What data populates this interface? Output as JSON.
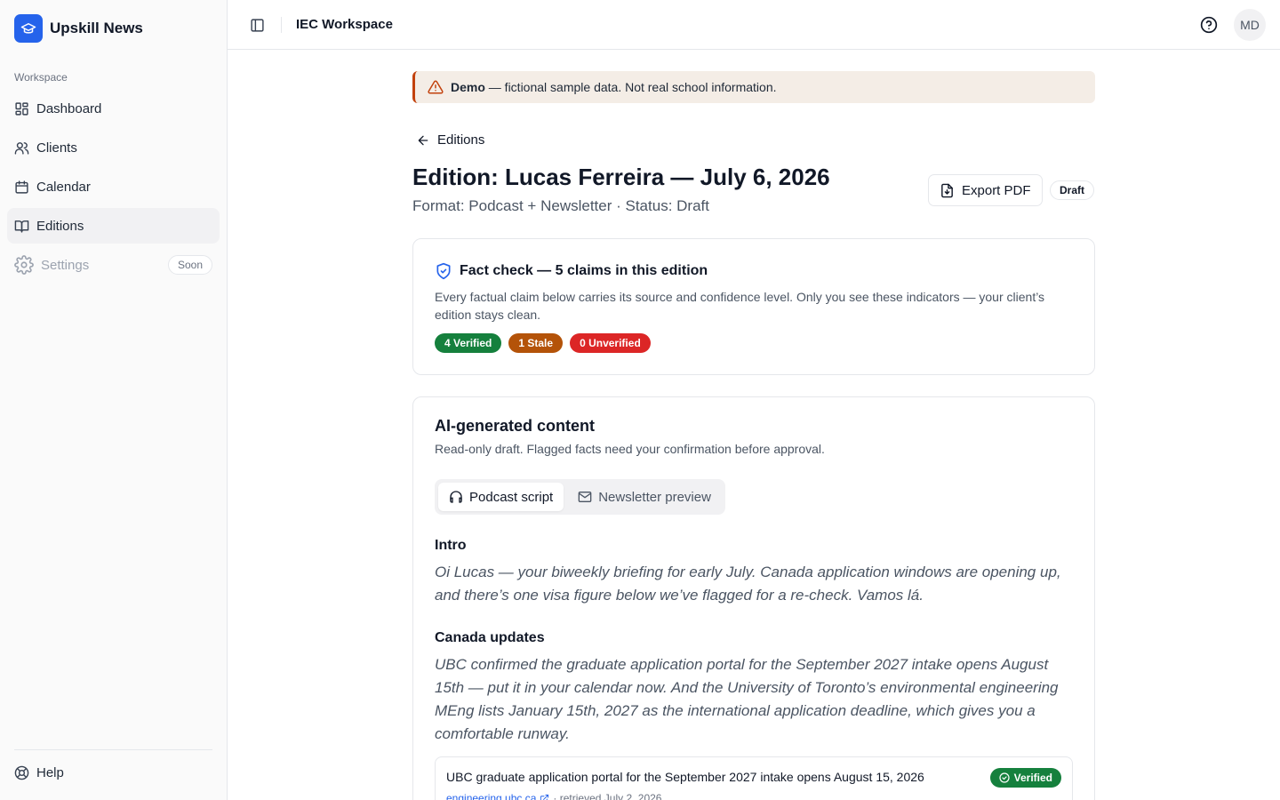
{
  "app": {
    "name": "Upskill News"
  },
  "sidebar": {
    "section_label": "Workspace",
    "items": [
      {
        "label": "Dashboard",
        "icon": "dashboard-icon"
      },
      {
        "label": "Clients",
        "icon": "users-icon"
      },
      {
        "label": "Calendar",
        "icon": "calendar-icon"
      },
      {
        "label": "Editions",
        "icon": "book-icon",
        "active": true
      },
      {
        "label": "Settings",
        "icon": "gear-icon",
        "badge": "Soon",
        "disabled": true
      }
    ],
    "help_label": "Help"
  },
  "header": {
    "workspace_title": "IEC Workspace",
    "avatar_initials": "MD"
  },
  "banner": {
    "strong": "Demo",
    "text": " — fictional sample data. Not real school information."
  },
  "page": {
    "back_label": "Editions",
    "title": "Edition: Lucas Ferreira — July 6, 2026",
    "subtitle": "Format: Podcast + Newsletter · Status: Draft",
    "export_label": "Export PDF",
    "status_badge": "Draft"
  },
  "fact_check": {
    "title": "Fact check — 5 claims in this edition",
    "description": "Every factual claim below carries its source and confidence level. Only you see these indicators — your client’s edition stays clean.",
    "pills": [
      {
        "label": "4 Verified",
        "color": "#15803d"
      },
      {
        "label": "1 Stale",
        "color": "#b45309"
      },
      {
        "label": "0 Unverified",
        "color": "#dc2626"
      }
    ]
  },
  "ai_content": {
    "title": "AI-generated content",
    "description": "Read-only draft. Flagged facts need your confirmation before approval.",
    "tabs": [
      {
        "label": "Podcast script",
        "active": true
      },
      {
        "label": "Newsletter preview",
        "active": false
      }
    ],
    "sections": [
      {
        "heading": "Intro",
        "body": "Oi Lucas — your biweekly briefing for early July. Canada application windows are opening up, and there’s one visa figure below we’ve flagged for a re-check. Vamos lá."
      },
      {
        "heading": "Canada updates",
        "body": "UBC confirmed the graduate application portal for the September 2027 intake opens August 15th — put it in your calendar now. And the University of Toronto’s environmental engineering MEng lists January 15th, 2027 as the international application deadline, which gives you a comfortable runway."
      }
    ],
    "claim": {
      "text": "UBC graduate application portal for the September 2027 intake opens August 15, 2026",
      "source": "engineering.ubc.ca",
      "retrieved": "· retrieved July 2, 2026",
      "status": "Verified"
    }
  },
  "colors": {
    "accent": "#2563eb",
    "verified": "#15803d",
    "stale": "#b45309",
    "unverified": "#dc2626",
    "banner_bg": "#f4ede6",
    "banner_border": "#c2410c"
  }
}
